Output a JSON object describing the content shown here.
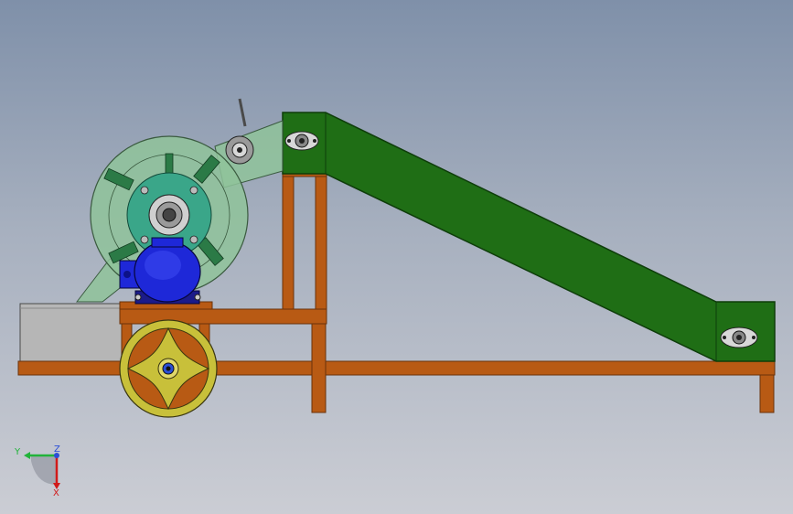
{
  "viewport": {
    "background_top": "#7f90a9",
    "background_bottom": "#cbcdd4"
  },
  "colors": {
    "frame": "#b85a14",
    "frame_dark": "#7a3a0c",
    "conveyor": "#1f6e15",
    "conveyor_dark": "#0e3d0a",
    "crusher_housing": "#8fc39a",
    "rotor_teal": "#3aa689",
    "motor_blue": "#1e28d8",
    "motor_dark": "#0c1288",
    "pulley": "#c8c03a",
    "hopper": "#b8b8b8"
  },
  "triad": {
    "labels": {
      "y": "Y",
      "z": "Z",
      "x": "X"
    },
    "y_color": "#21b33a",
    "z_color": "#2b4fd6",
    "x_color": "#d11a1a"
  }
}
